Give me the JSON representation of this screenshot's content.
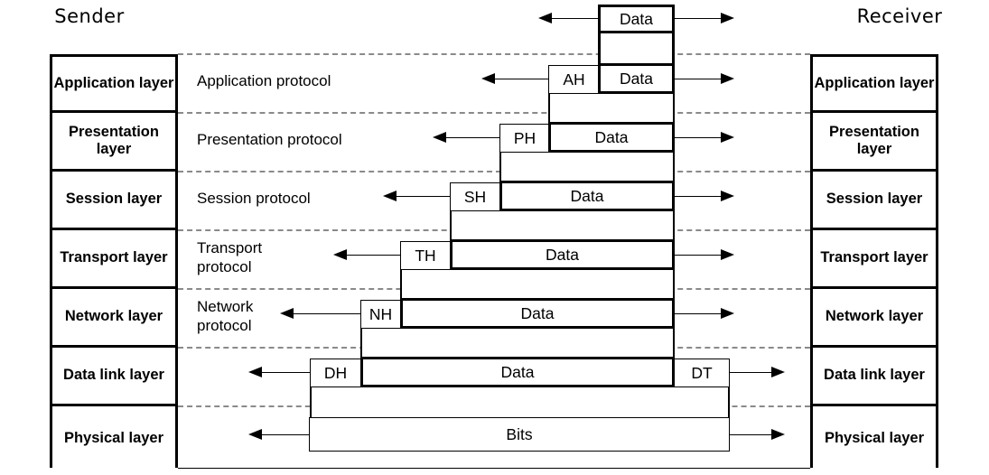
{
  "diagram": {
    "title_sender": "Sender",
    "title_receiver": "Receiver"
  },
  "sender_layers": [
    {
      "label": "Application\nlayer"
    },
    {
      "label": "Presentation\nlayer"
    },
    {
      "label": "Session\nlayer"
    },
    {
      "label": "Transport\nlayer"
    },
    {
      "label": "Network\nlayer"
    },
    {
      "label": "Data link\nlayer"
    },
    {
      "label": "Physical\nlayer"
    }
  ],
  "receiver_layers": [
    {
      "label": "Application\nlayer"
    },
    {
      "label": "Presentation\nlayer"
    },
    {
      "label": "Session\nlayer"
    },
    {
      "label": "Transport\nlayer"
    },
    {
      "label": "Network\nlayer"
    },
    {
      "label": "Data link\nlayer"
    },
    {
      "label": "Physical\nlayer"
    }
  ],
  "protocols": [
    {
      "label": "Application protocol"
    },
    {
      "label": "Presentation protocol"
    },
    {
      "label": "Session protocol"
    },
    {
      "label": "Transport\nprotocol"
    },
    {
      "label": "Network\nprotocol"
    },
    {
      "label": ""
    },
    {
      "label": ""
    }
  ],
  "pdus": {
    "top": {
      "data": "Data"
    },
    "application": {
      "header": "AH",
      "data": "Data"
    },
    "presentation": {
      "header": "PH",
      "data": "Data"
    },
    "session": {
      "header": "SH",
      "data": "Data"
    },
    "transport": {
      "header": "TH",
      "data": "Data"
    },
    "network": {
      "header": "NH",
      "data": "Data"
    },
    "datalink": {
      "header": "DH",
      "data": "Data",
      "trailer": "DT"
    },
    "physical": {
      "data": "Bits"
    }
  },
  "colors": {
    "line": "#000000",
    "dashed_separator": "#8a8a8a",
    "background": "#ffffff"
  }
}
